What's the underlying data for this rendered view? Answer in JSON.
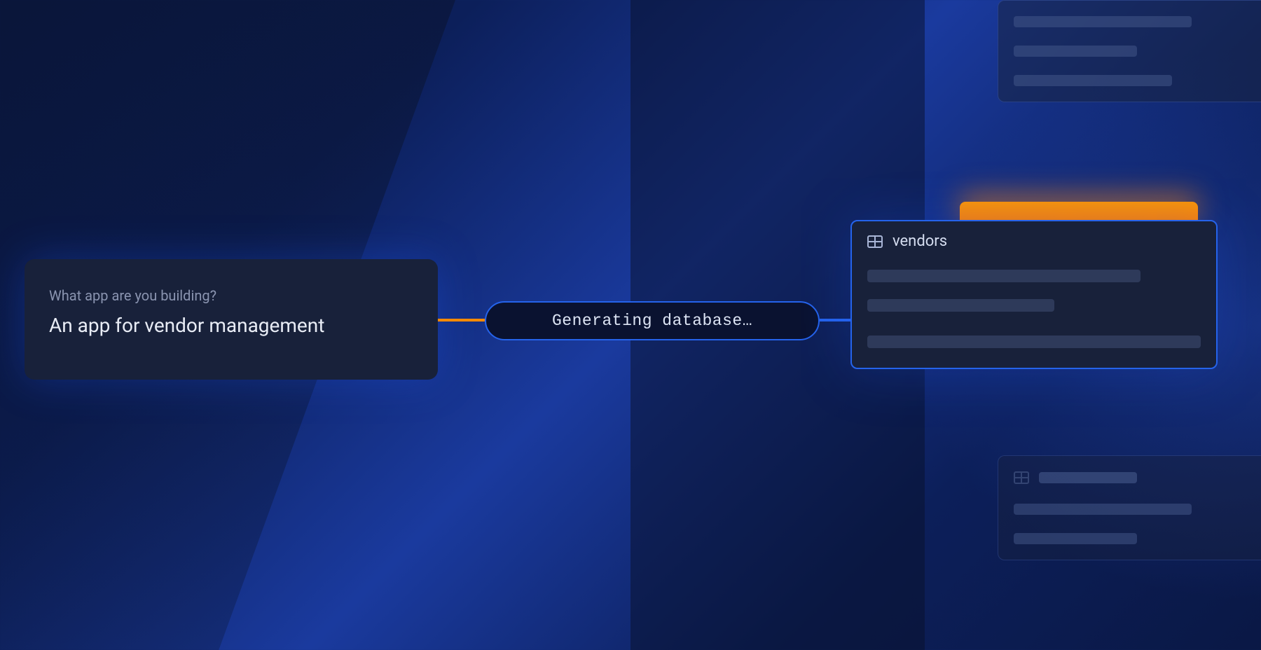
{
  "prompt": {
    "label": "What app are you building?",
    "text": "An app for vendor management"
  },
  "status": {
    "text": "Generating database…"
  },
  "tables": {
    "main": {
      "name": "vendors"
    }
  }
}
